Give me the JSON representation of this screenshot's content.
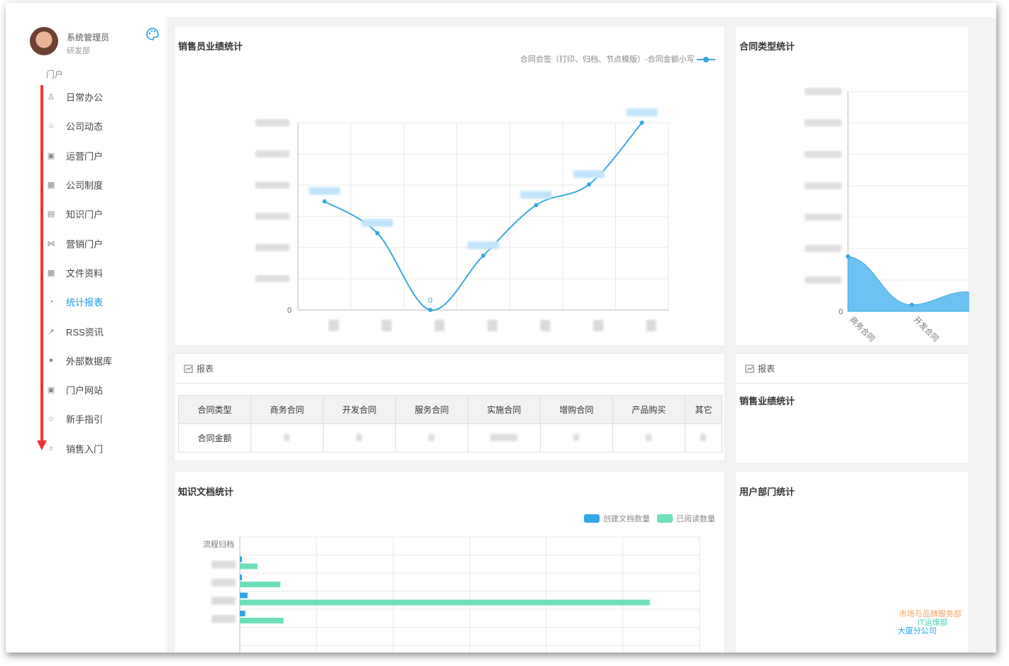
{
  "user": {
    "name": "系统管理员",
    "dept": "研发部"
  },
  "sidebar": {
    "section": "门户",
    "items": [
      {
        "label": "日常办公",
        "icon": "user-icon"
      },
      {
        "label": "公司动态",
        "icon": "people-icon"
      },
      {
        "label": "运营门户",
        "icon": "image-icon"
      },
      {
        "label": "公司制度",
        "icon": "grid-icon"
      },
      {
        "label": "知识门户",
        "icon": "book-icon"
      },
      {
        "label": "营销门户",
        "icon": "share-icon"
      },
      {
        "label": "文件资料",
        "icon": "grid-icon"
      },
      {
        "label": "统计报表",
        "icon": "pie-chart-icon",
        "active": true
      },
      {
        "label": "RSS资讯",
        "icon": "rss-icon"
      },
      {
        "label": "外部数据库",
        "icon": "link-icon"
      },
      {
        "label": "门户网站",
        "icon": "image-icon"
      },
      {
        "label": "新手指引",
        "icon": "star-icon"
      },
      {
        "label": "销售入门",
        "icon": "sun-icon"
      }
    ]
  },
  "sales_perf": {
    "title": "销售员业绩统计",
    "legend": "合同会签（打印、归档、节点模版）-合同金额小写",
    "series_color": "#3aa8e0"
  },
  "contract_type": {
    "title": "合同类型统计",
    "x_labels": [
      "商务合同",
      "开发合同"
    ],
    "area_color": "#6cc3f3"
  },
  "report1": {
    "head": "报表",
    "header_row": [
      "合同类型",
      "商务合同",
      "开发合同",
      "服务合同",
      "实施合同",
      "增购合同",
      "产品购买",
      "其它"
    ],
    "row_label": "合同金额"
  },
  "report2": {
    "head": "报表",
    "title": "销售业绩统计"
  },
  "knowledge": {
    "title": "知识文档统计",
    "legend": [
      "创建文档数量",
      "已阅读数量"
    ],
    "colors": [
      "#2fa7ea",
      "#6ee0b9"
    ],
    "first_category": "流程归档"
  },
  "dept_stats": {
    "title": "用户部门统计",
    "labels": [
      "市场与品牌服务部",
      "IT运维部",
      "大厦分公司"
    ],
    "colors": [
      "#f5a15c",
      "#3fd0b5",
      "#2aa6e8"
    ]
  },
  "chart_data": [
    {
      "type": "line",
      "title": "销售员业绩统计",
      "series": [
        {
          "name": "合同会签（打印、归档、节点模版）-合同金额小写",
          "values": [
            0.58,
            0.41,
            0.0,
            0.29,
            0.56,
            0.67,
            1.0
          ]
        }
      ],
      "point_labels": [
        "",
        "",
        "0",
        "",
        "",
        "",
        ""
      ],
      "y_ticks": [
        "0"
      ],
      "ylim": [
        0,
        1
      ],
      "grid": true
    },
    {
      "type": "area",
      "title": "合同类型统计",
      "categories": [
        "商务合同",
        "开发合同"
      ],
      "values": [
        0.25,
        0.03
      ],
      "y_ticks": [
        "0"
      ],
      "ylim": [
        0,
        1
      ]
    },
    {
      "type": "bar",
      "title": "知识文档统计",
      "orientation": "horizontal",
      "categories": [
        "流程归档",
        "",
        "",
        "",
        ""
      ],
      "series": [
        {
          "name": "创建文档数量",
          "values": [
            0,
            0.4,
            0.5,
            2.0,
            1.4
          ]
        },
        {
          "name": "已阅读数量",
          "values": [
            0,
            4.6,
            10.6,
            107,
            11.4
          ]
        }
      ],
      "xlim": [
        0,
        120
      ],
      "grid": true
    }
  ]
}
